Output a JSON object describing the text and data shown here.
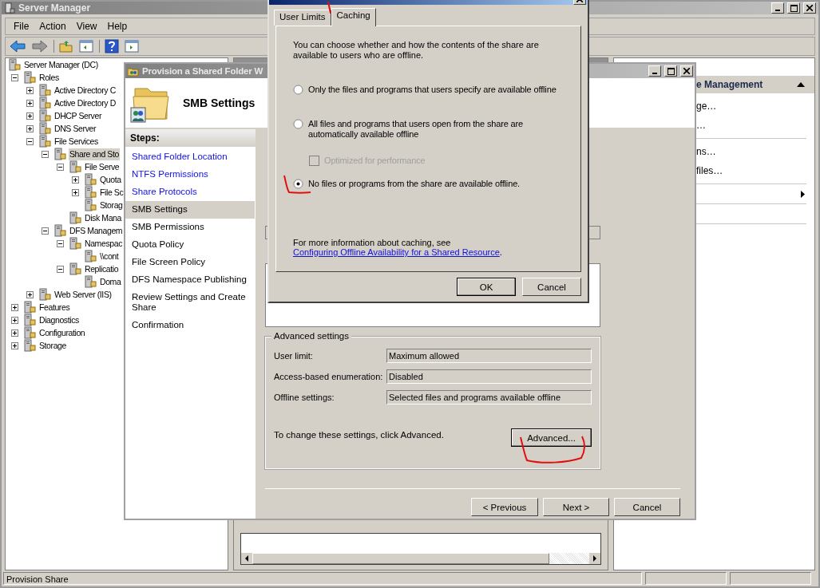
{
  "server_manager": {
    "title": "Server Manager",
    "menu": [
      "File",
      "Action",
      "View",
      "Help"
    ],
    "tree": [
      {
        "label": "Server Manager (DC)",
        "selected": false,
        "children": [
          {
            "label": "Roles",
            "expanded": true,
            "selected": false,
            "children": [
              {
                "label": "Active Directory C",
                "expanded": false,
                "selected": false
              },
              {
                "label": "Active Directory D",
                "expanded": false,
                "selected": false
              },
              {
                "label": "DHCP Server",
                "expanded": false,
                "selected": false
              },
              {
                "label": "DNS Server",
                "expanded": false,
                "selected": false
              },
              {
                "label": "File Services",
                "expanded": true,
                "selected": false,
                "children": [
                  {
                    "label": "Share and Sto",
                    "expanded": true,
                    "selected": true,
                    "children": [
                      {
                        "label": "File Serve",
                        "expanded": true,
                        "selected": false,
                        "children": [
                          {
                            "label": "Quota",
                            "expanded": false,
                            "selected": false
                          },
                          {
                            "label": "File Sc",
                            "expanded": false,
                            "selected": false
                          },
                          {
                            "label": "Storag",
                            "selected": false
                          }
                        ]
                      },
                      {
                        "label": "Disk Mana",
                        "selected": false
                      }
                    ]
                  },
                  {
                    "label": "DFS Managem",
                    "expanded": true,
                    "selected": false,
                    "children": [
                      {
                        "label": "Namespac",
                        "expanded": true,
                        "selected": false,
                        "children": [
                          {
                            "label": "\\\\cont",
                            "selected": false
                          }
                        ]
                      },
                      {
                        "label": "Replicatio",
                        "expanded": true,
                        "selected": false,
                        "children": [
                          {
                            "label": "Doma",
                            "selected": false
                          }
                        ]
                      }
                    ]
                  }
                ]
              },
              {
                "label": "Web Server (IIS)",
                "expanded": false,
                "selected": false
              }
            ]
          },
          {
            "label": "Features",
            "expanded": false,
            "selected": false
          },
          {
            "label": "Diagnostics",
            "expanded": false,
            "selected": false
          },
          {
            "label": "Configuration",
            "expanded": false,
            "selected": false
          },
          {
            "label": "Storage",
            "expanded": false,
            "selected": false
          }
        ]
      }
    ],
    "actions": {
      "header": "e Management",
      "groups": [
        [
          {
            "kind": "link",
            "label": "ge…"
          },
          {
            "kind": "link",
            "label": "…"
          }
        ],
        [
          {
            "kind": "link",
            "label": "ns…"
          },
          {
            "kind": "link",
            "label": "files…"
          }
        ],
        [
          {
            "kind": "submenu"
          }
        ]
      ]
    },
    "status_bar": "Provision Share"
  },
  "wizard": {
    "title": "Provision a Shared Folder W",
    "heading": "SMB Settings",
    "steps_title": "Steps:",
    "steps": [
      {
        "label": "Shared Folder Location",
        "completed": true,
        "selected": false
      },
      {
        "label": "NTFS Permissions",
        "completed": true,
        "selected": false
      },
      {
        "label": "Share Protocols",
        "completed": true,
        "selected": false
      },
      {
        "label": "SMB Settings",
        "completed": false,
        "selected": true
      },
      {
        "label": "SMB Permissions",
        "completed": false,
        "selected": false
      },
      {
        "label": "Quota Policy",
        "completed": false,
        "selected": false
      },
      {
        "label": "File Screen Policy",
        "completed": false,
        "selected": false
      },
      {
        "label": "DFS Namespace Publishing",
        "completed": false,
        "selected": false
      },
      {
        "label": "Review Settings and Create Share",
        "completed": false,
        "selected": false
      },
      {
        "label": "Confirmation",
        "completed": false,
        "selected": false
      }
    ],
    "advanced_settings": {
      "title": "Advanced settings",
      "fields": [
        {
          "label": "User limit:",
          "value": "Maximum allowed"
        },
        {
          "label": "Access-based enumeration:",
          "value": "Disabled"
        },
        {
          "label": "Offline settings:",
          "value": "Selected files and programs available offline"
        }
      ],
      "hint": "To change these settings, click Advanced.",
      "button": "Advanced..."
    },
    "buttons": [
      "< Previous",
      "Next >",
      "Cancel"
    ]
  },
  "dialog": {
    "tabs": [
      {
        "label": "User Limits",
        "selected": false
      },
      {
        "label": "Caching",
        "selected": true
      }
    ],
    "description": "You can choose whether and how the contents of the share are available to users who are offline.",
    "options": [
      {
        "kind": "radio",
        "label": "Only the files and programs that users specify are available offline",
        "selected": false,
        "disabled": false
      },
      {
        "kind": "radio",
        "label": "All files and programs that users open from the share are automatically available offline",
        "selected": false,
        "disabled": false
      },
      {
        "kind": "checkbox",
        "label": "Optimized for performance",
        "checked": false,
        "disabled": true
      },
      {
        "kind": "radio",
        "label": "No files or programs from the share are available offline.",
        "selected": true,
        "disabled": false
      }
    ],
    "info": {
      "text": "For more information about caching, see ",
      "link": "Configuring Offline Availability for a Shared Resource",
      "end": "."
    },
    "buttons": [
      "OK",
      "Cancel"
    ]
  }
}
